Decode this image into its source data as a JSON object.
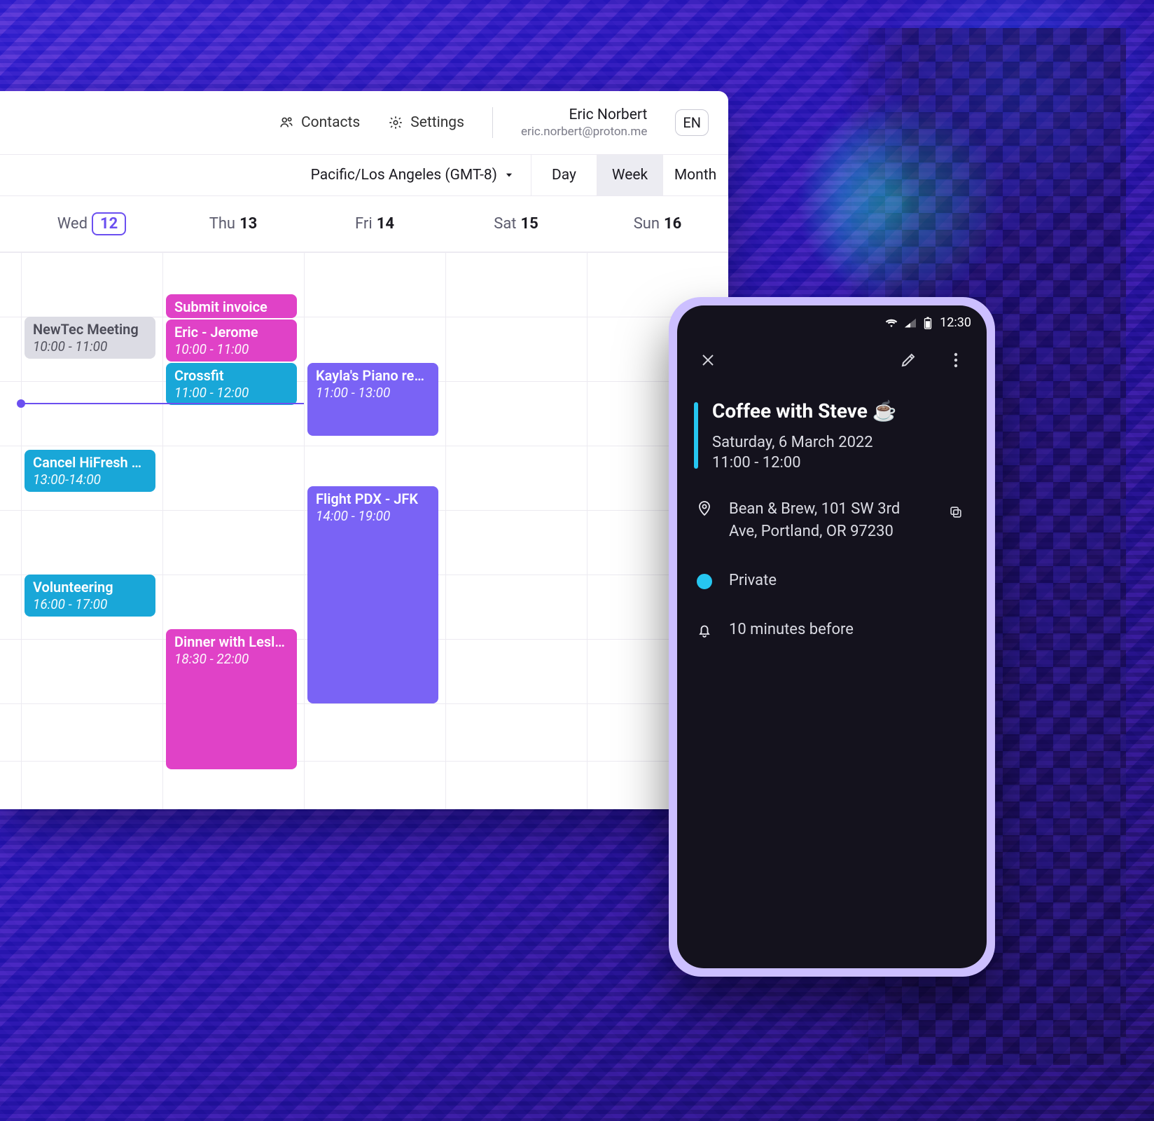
{
  "colors": {
    "accent": "#6b4ff0",
    "pink": "#e042c7",
    "violet": "#7a63f5",
    "cyan": "#19a7d8",
    "gray": "#dcdce4",
    "phone_accent": "#26c6f0",
    "phone_bg": "#14121d"
  },
  "desktop": {
    "header": {
      "contacts_label": "Contacts",
      "settings_label": "Settings",
      "user_name": "Eric Norbert",
      "user_email": "eric.norbert@proton.me",
      "language": "EN"
    },
    "controls": {
      "timezone_label": "Pacific/Los Angeles (GMT-8)",
      "views": [
        {
          "label": "Day",
          "active": false
        },
        {
          "label": "Week",
          "active": true
        },
        {
          "label": "Month",
          "active": false
        }
      ]
    },
    "days": [
      {
        "dow": "Wed",
        "num": "12",
        "today": true
      },
      {
        "dow": "Thu",
        "num": "13",
        "today": false
      },
      {
        "dow": "Fri",
        "num": "14",
        "today": false
      },
      {
        "dow": "Sat",
        "num": "15",
        "today": false
      },
      {
        "dow": "Sun",
        "num": "16",
        "today": false
      }
    ],
    "events": {
      "newtec": {
        "title": "NewTec Meeting",
        "time": "10:00 - 11:00"
      },
      "cancel": {
        "title": "Cancel HiFresh s…",
        "time": "13:00-14:00"
      },
      "volunteer": {
        "title": "Volunteering",
        "time": "16:00 - 17:00"
      },
      "invoice": {
        "title": "Submit invoice",
        "time": ""
      },
      "eric": {
        "title": "Eric - Jerome",
        "time": "10:00 - 11:00"
      },
      "crossfit": {
        "title": "Crossfit",
        "time": "11:00 - 12:00"
      },
      "dinner": {
        "title": "Dinner with Leslie…",
        "time": "18:30 - 22:00"
      },
      "piano": {
        "title": "Kayla's Piano reci…",
        "time": "11:00 - 13:00"
      },
      "flight": {
        "title": "Flight PDX - JFK",
        "time": "14:00 - 19:00"
      }
    }
  },
  "phone": {
    "status_time": "12:30",
    "event": {
      "title": "Coffee with Steve ☕",
      "date": "Saturday, 6 March 2022",
      "time": "11:00 - 12:00",
      "location": "Bean & Brew, 101 SW 3rd Ave, Portland, OR 97230",
      "visibility": "Private",
      "reminder": "10 minutes before"
    }
  }
}
